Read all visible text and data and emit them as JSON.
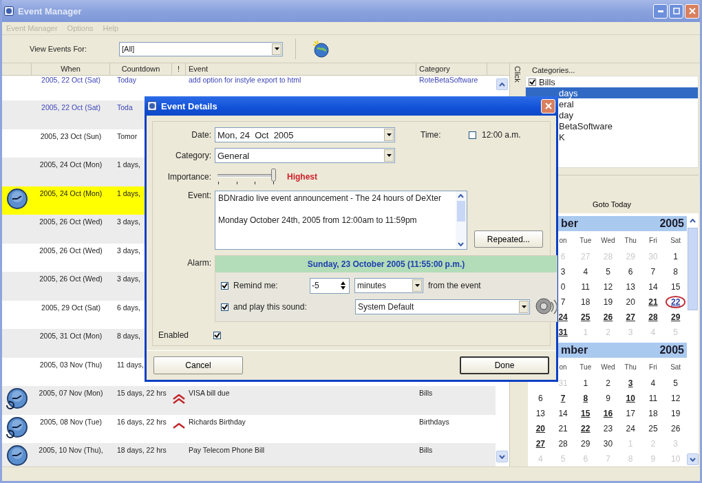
{
  "window": {
    "title": "Event Manager"
  },
  "menu": [
    {
      "label": "Event Manager",
      "disabled": true
    },
    {
      "label": "Options",
      "disabled": true
    },
    {
      "label": "Help",
      "disabled": true
    }
  ],
  "toolbar": {
    "label": "View Events For:",
    "filter": "[All]"
  },
  "table": {
    "columns": [
      "When",
      "Countdown",
      "!",
      "Event",
      "Category"
    ],
    "rows": [
      {
        "when": "2005, 22 Oct (Sat)",
        "countdown": "Today",
        "event": "add option for instyle export to html",
        "category": "RoteBetaSoftware",
        "kind": "today",
        "selected": false,
        "alarm": false,
        "recurring": false,
        "high_priority": false,
        "highest_priority": false
      },
      {
        "when": "2005, 22 Oct (Sat)",
        "countdown": "Toda",
        "kind": "today",
        "selected": false,
        "alarm": false,
        "recurring": false
      },
      {
        "when": "2005, 23 Oct (Sun)",
        "countdown": "Tomor",
        "kind": "normal",
        "selected": false,
        "alarm": false,
        "recurring": false
      },
      {
        "when": "2005, 24 Oct (Mon)",
        "countdown": "1 days,",
        "kind": "normal",
        "selected": false,
        "alarm": false,
        "recurring": false
      },
      {
        "when": "2005, 24 Oct (Mon)",
        "countdown": "1 days,",
        "kind": "normal",
        "selected": true,
        "alarm": true,
        "recurring": false
      },
      {
        "when": "2005, 26 Oct (Wed)",
        "countdown": "3 days,",
        "kind": "normal",
        "selected": false,
        "alarm": false,
        "recurring": false
      },
      {
        "when": "2005, 26 Oct (Wed)",
        "countdown": "3 days,",
        "kind": "normal",
        "selected": false,
        "alarm": false,
        "recurring": false
      },
      {
        "when": "2005, 26 Oct (Wed)",
        "countdown": "3 days,",
        "kind": "normal",
        "selected": false,
        "alarm": false,
        "recurring": false
      },
      {
        "when": "2005, 29 Oct (Sat)",
        "countdown": "6 days,",
        "kind": "normal",
        "selected": false,
        "alarm": false,
        "recurring": false
      },
      {
        "when": "2005, 31 Oct (Mon)",
        "countdown": "8 days,",
        "kind": "normal",
        "selected": false,
        "alarm": false,
        "recurring": false
      },
      {
        "when": "2005, 03 Nov (Thu)",
        "countdown": "11 days,",
        "kind": "normal",
        "selected": false,
        "alarm": false,
        "recurring": false
      },
      {
        "when": "2005, 07 Nov (Mon)",
        "countdown": "15 days, 22 hrs",
        "event": "VISA bill due",
        "category": "Bills",
        "kind": "normal",
        "selected": false,
        "alarm": true,
        "recurring": true,
        "high_priority": false,
        "highest_priority": true
      },
      {
        "when": "2005, 08 Nov (Tue)",
        "countdown": "16 days, 22 hrs",
        "event": "Richards Birthday",
        "category": "Birthdays",
        "kind": "normal",
        "selected": false,
        "alarm": true,
        "recurring": true,
        "high_priority": true,
        "highest_priority": false
      },
      {
        "when": "2005, 10 Nov (Thu),",
        "countdown": "18 days, 22 hrs",
        "event": "Pay Telecom Phone Bill",
        "category": "Bills",
        "kind": "normal",
        "selected": false,
        "alarm": true,
        "recurring": false,
        "high_priority": false,
        "highest_priority": false
      }
    ]
  },
  "side_strip": {
    "label": "Click"
  },
  "categories": {
    "title": "Categories...",
    "items": [
      {
        "label": "Bills",
        "checked": true,
        "selected": false
      },
      {
        "label": "days",
        "selected": true
      },
      {
        "label": "eral",
        "selected": false
      },
      {
        "label": "day",
        "selected": false
      },
      {
        "label": "BetaSoftware",
        "selected": false
      },
      {
        "label": "K",
        "selected": false
      }
    ]
  },
  "goto_today": "Goto Today",
  "months": [
    {
      "name": "ber",
      "year": "2005",
      "weekdays": [
        "on",
        "Tue",
        "Wed",
        "Thu",
        "Fri",
        "Sat"
      ],
      "weeks": [
        [
          {
            "day": "6",
            "kind": "other"
          },
          {
            "day": "27",
            "kind": "other"
          },
          {
            "day": "28",
            "kind": "other"
          },
          {
            "day": "29",
            "kind": "other"
          },
          {
            "day": "30",
            "kind": "other"
          },
          {
            "day": "1",
            "kind": "plain"
          }
        ],
        [
          {
            "day": "3",
            "kind": "plain"
          },
          {
            "day": "4",
            "kind": "plain"
          },
          {
            "day": "5",
            "kind": "plain"
          },
          {
            "day": "6",
            "kind": "plain"
          },
          {
            "day": "7",
            "kind": "plain"
          },
          {
            "day": "8",
            "kind": "plain"
          }
        ],
        [
          {
            "day": "0",
            "kind": "plain"
          },
          {
            "day": "11",
            "kind": "plain"
          },
          {
            "day": "12",
            "kind": "plain"
          },
          {
            "day": "13",
            "kind": "plain"
          },
          {
            "day": "14",
            "kind": "plain"
          },
          {
            "day": "15",
            "kind": "plain"
          }
        ],
        [
          {
            "day": "7",
            "kind": "plain"
          },
          {
            "day": "18",
            "kind": "plain"
          },
          {
            "day": "19",
            "kind": "plain"
          },
          {
            "day": "20",
            "kind": "plain"
          },
          {
            "day": "21",
            "kind": "event"
          },
          {
            "day": "22",
            "kind": "today"
          }
        ],
        [
          {
            "day": "24",
            "kind": "event"
          },
          {
            "day": "25",
            "kind": "event"
          },
          {
            "day": "26",
            "kind": "event"
          },
          {
            "day": "27",
            "kind": "event"
          },
          {
            "day": "28",
            "kind": "event"
          },
          {
            "day": "29",
            "kind": "event"
          }
        ],
        [
          {
            "day": "31",
            "kind": "event"
          },
          {
            "day": "1",
            "kind": "other"
          },
          {
            "day": "2",
            "kind": "other"
          },
          {
            "day": "3",
            "kind": "other"
          },
          {
            "day": "4",
            "kind": "other"
          },
          {
            "day": "5",
            "kind": "other"
          }
        ]
      ]
    },
    {
      "name": "mber",
      "year": "2005",
      "weekdays": [
        "on",
        "Tue",
        "Wed",
        "Thu",
        "Fri",
        "Sat"
      ],
      "weeks": [
        [
          {
            "day": "31",
            "kind": "other"
          },
          {
            "day": "1",
            "kind": "plain"
          },
          {
            "day": "2",
            "kind": "plain"
          },
          {
            "day": "3",
            "kind": "event"
          },
          {
            "day": "4",
            "kind": "plain"
          },
          {
            "day": "5",
            "kind": "plain"
          }
        ],
        [
          {
            "day": "6",
            "kind": "plain"
          },
          {
            "day": "7",
            "kind": "event"
          },
          {
            "day": "8",
            "kind": "event"
          },
          {
            "day": "9",
            "kind": "plain"
          },
          {
            "day": "10",
            "kind": "event"
          },
          {
            "day": "11",
            "kind": "plain"
          },
          {
            "day": "12",
            "kind": "plain"
          }
        ],
        [
          {
            "day": "13",
            "kind": "plain"
          },
          {
            "day": "14",
            "kind": "plain"
          },
          {
            "day": "15",
            "kind": "event"
          },
          {
            "day": "16",
            "kind": "event"
          },
          {
            "day": "17",
            "kind": "plain"
          },
          {
            "day": "18",
            "kind": "plain"
          },
          {
            "day": "19",
            "kind": "plain"
          }
        ],
        [
          {
            "day": "20",
            "kind": "event"
          },
          {
            "day": "21",
            "kind": "plain"
          },
          {
            "day": "22",
            "kind": "event"
          },
          {
            "day": "23",
            "kind": "plain"
          },
          {
            "day": "24",
            "kind": "plain"
          },
          {
            "day": "25",
            "kind": "plain"
          },
          {
            "day": "26",
            "kind": "plain"
          }
        ],
        [
          {
            "day": "27",
            "kind": "event"
          },
          {
            "day": "28",
            "kind": "plain"
          },
          {
            "day": "29",
            "kind": "plain"
          },
          {
            "day": "30",
            "kind": "plain"
          },
          {
            "day": "1",
            "kind": "other"
          },
          {
            "day": "2",
            "kind": "other"
          },
          {
            "day": "3",
            "kind": "other"
          }
        ],
        [
          {
            "day": "4",
            "kind": "other"
          },
          {
            "day": "5",
            "kind": "other"
          },
          {
            "day": "6",
            "kind": "other"
          },
          {
            "day": "7",
            "kind": "other"
          },
          {
            "day": "8",
            "kind": "other"
          },
          {
            "day": "9",
            "kind": "other"
          },
          {
            "day": "10",
            "kind": "other"
          }
        ]
      ]
    }
  ],
  "dialog": {
    "title": "Event Details",
    "date_label": "Date:",
    "date": "Mon, 24  Oct  2005",
    "time_label": "Time:",
    "time_checked": false,
    "time": "12:00 a.m.",
    "category_label": "Category:",
    "category": "General",
    "importance_label": "Importance:",
    "importance": {
      "level": 1.0
    },
    "importance_text": "Highest",
    "event_label": "Event:",
    "event_lines": [
      "BDNradio live event announcement - The 24 hours of DeXter",
      "Monday October 24th, 2005 from 12:00am to 11:59pm"
    ],
    "repeated_button": "Repeated...",
    "alarm_label": "Alarm:",
    "alarm_time": "Sunday, 23 October 2005 (11:55:00 p.m.)",
    "remind_checked": true,
    "remind_label": "Remind me:",
    "remind_value": "-5",
    "remind_unit": "minutes",
    "remind_suffix": "from the event",
    "sound_checked": true,
    "sound_label": "and play this sound:",
    "sound": "System Default",
    "enabled_label": "Enabled",
    "enabled": true,
    "cancel_button": "Cancel",
    "done_button": "Done"
  }
}
